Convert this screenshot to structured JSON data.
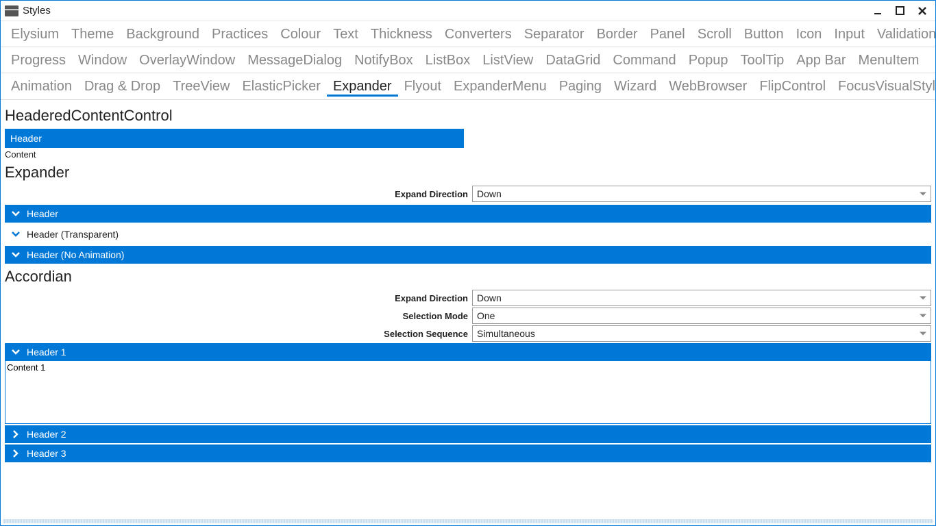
{
  "window": {
    "title": "Styles"
  },
  "tabs": {
    "row1": [
      "Elysium",
      "Theme",
      "Background",
      "Practices",
      "Colour",
      "Text",
      "Thickness",
      "Converters",
      "Separator",
      "Border",
      "Panel",
      "Scroll",
      "Button",
      "Icon",
      "Input",
      "Validation"
    ],
    "row2": [
      "Progress",
      "Window",
      "OverlayWindow",
      "MessageDialog",
      "NotifyBox",
      "ListBox",
      "ListView",
      "DataGrid",
      "Command",
      "Popup",
      "ToolTip",
      "App Bar",
      "MenuItem"
    ],
    "row3": [
      "Animation",
      "Drag & Drop",
      "TreeView",
      "ElasticPicker",
      "Expander",
      "Flyout",
      "ExpanderMenu",
      "Paging",
      "Wizard",
      "WebBrowser",
      "FlipControl",
      "FocusVisualStyle"
    ],
    "active": "Expander"
  },
  "sections": {
    "hcc": {
      "title": "HeaderedContentControl",
      "header": "Header",
      "content": "Content"
    },
    "expander": {
      "title": "Expander",
      "direction_label": "Expand Direction",
      "direction_value": "Down",
      "items": [
        {
          "label": "Header",
          "style": "filled"
        },
        {
          "label": "Header (Transparent)",
          "style": "transparent"
        },
        {
          "label": "Header (No Animation)",
          "style": "filled"
        }
      ]
    },
    "accordian": {
      "title": "Accordian",
      "fields": [
        {
          "label": "Expand Direction",
          "value": "Down"
        },
        {
          "label": "Selection Mode",
          "value": "One"
        },
        {
          "label": "Selection Sequence",
          "value": "Simultaneous"
        }
      ],
      "items": [
        {
          "header": "Header 1",
          "expanded": true,
          "content": "Content 1"
        },
        {
          "header": "Header 2",
          "expanded": false
        },
        {
          "header": "Header 3",
          "expanded": false
        }
      ]
    }
  }
}
